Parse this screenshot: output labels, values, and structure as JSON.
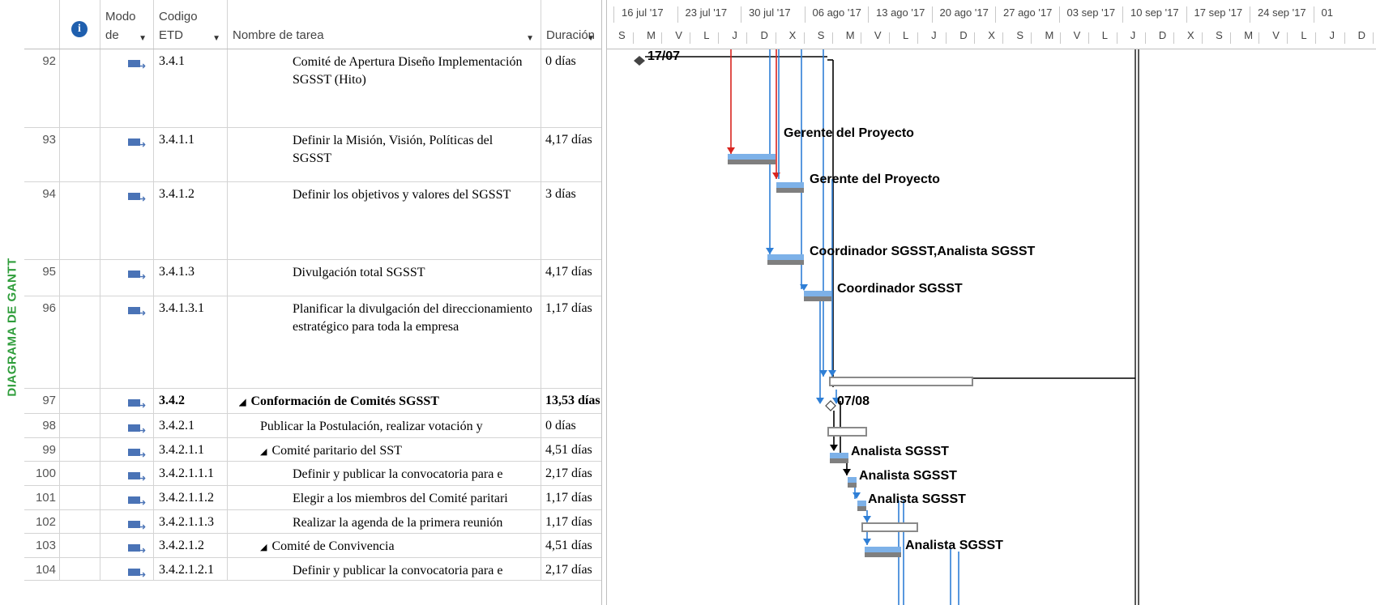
{
  "side_label": "DIAGRAMA DE GANTT",
  "columns": {
    "mode": [
      "Modo",
      "de"
    ],
    "code": [
      "Codigo",
      "ETD"
    ],
    "name": "Nombre de tarea",
    "duration": "Duración",
    "info_symbol": "i"
  },
  "timescale": {
    "weeks": [
      "16 jul '17",
      "23 jul '17",
      "30 jul '17",
      "06 ago '17",
      "13 ago '17",
      "20 ago '17",
      "27 ago '17",
      "03 sep '17",
      "10 sep '17",
      "17 sep '17",
      "24 sep '17",
      "01"
    ],
    "days": [
      "S",
      "M",
      "V",
      "L",
      "J",
      "D",
      "X",
      "S",
      "M",
      "V",
      "L",
      "J",
      "D",
      "X",
      "S",
      "M",
      "V",
      "L",
      "J",
      "D",
      "X",
      "S",
      "M",
      "V",
      "L",
      "J",
      "D"
    ]
  },
  "rows": [
    {
      "id": "92",
      "code": "3.4.1",
      "name": "Comité de Apertura Diseño Implementación SGSST (Hito)",
      "duration": "0 días",
      "bold": false,
      "summary": false,
      "indent": 3
    },
    {
      "id": "93",
      "code": "3.4.1.1",
      "name": "Definir la Misión, Visión, Políticas del SGSST",
      "duration": "4,17 días",
      "bold": false,
      "summary": false,
      "indent": 3
    },
    {
      "id": "94",
      "code": "3.4.1.2",
      "name": "Definir los objetivos y valores del SGSST",
      "duration": "3 días",
      "bold": false,
      "summary": false,
      "indent": 3
    },
    {
      "id": "95",
      "code": "3.4.1.3",
      "name": "Divulgación total SGSST",
      "duration": "4,17 días",
      "bold": false,
      "summary": false,
      "indent": 3
    },
    {
      "id": "96",
      "code": "3.4.1.3.1",
      "name": "Planificar la divulgación del direccionamiento estratégico para toda la empresa",
      "duration": "1,17 días",
      "bold": false,
      "summary": false,
      "indent": 3
    },
    {
      "id": "97",
      "code": "3.4.2",
      "name": "Conformación de Comités SGSST",
      "duration": "13,53 días",
      "bold": true,
      "summary": true,
      "indent": 1
    },
    {
      "id": "98",
      "code": "3.4.2.1",
      "name": "Publicar la Postulación, realizar votación y",
      "duration": "0 días",
      "bold": false,
      "summary": false,
      "indent": 2
    },
    {
      "id": "99",
      "code": "3.4.2.1.1",
      "name": "Comité paritario del SST",
      "duration": "4,51 días",
      "bold": false,
      "summary": true,
      "indent": 2
    },
    {
      "id": "100",
      "code": "3.4.2.1.1.1",
      "name": "Definir y publicar la convocatoria para e",
      "duration": "2,17 días",
      "bold": false,
      "summary": false,
      "indent": 3
    },
    {
      "id": "101",
      "code": "3.4.2.1.1.2",
      "name": "Elegir a los miembros del Comité paritari",
      "duration": "1,17 días",
      "bold": false,
      "summary": false,
      "indent": 3
    },
    {
      "id": "102",
      "code": "3.4.2.1.1.3",
      "name": "Realizar la agenda de la primera reunión",
      "duration": "1,17 días",
      "bold": false,
      "summary": false,
      "indent": 3
    },
    {
      "id": "103",
      "code": "3.4.2.1.2",
      "name": "Comité de Convivencia",
      "duration": "4,51 días",
      "bold": false,
      "summary": true,
      "indent": 2
    },
    {
      "id": "104",
      "code": "3.4.2.1.2.1",
      "name": "Definir y publicar la convocatoria para e",
      "duration": "2,17 días",
      "bold": false,
      "summary": false,
      "indent": 3
    }
  ],
  "gantt": {
    "milestone_labels": [
      "17/07",
      "07/08"
    ],
    "resources": {
      "r93": "Gerente del Proyecto",
      "r94": "Gerente del Proyecto",
      "r95": "Coordinador SGSST,Analista SGSST",
      "r96": "Coordinador SGSST",
      "r100": "Analista SGSST",
      "r101": "Analista SGSST",
      "r102": "Analista SGSST",
      "r104": "Analista SGSST"
    },
    "colors": {
      "task_top": "#7db1e8",
      "task_bottom": "#7f7f7f",
      "link_blue": "#2f7fd6",
      "link_red": "#d9241f",
      "side_label": "#2e9d3a"
    }
  }
}
